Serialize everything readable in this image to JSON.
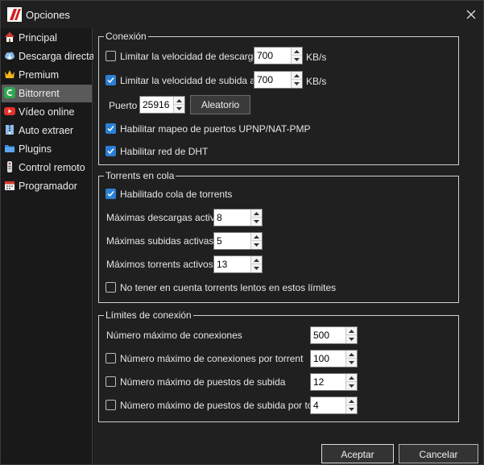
{
  "window": {
    "title": "Opciones"
  },
  "sidebar": {
    "items": [
      {
        "label": "Principal",
        "icon": "home-icon"
      },
      {
        "label": "Descarga directa",
        "icon": "cloud-download-icon"
      },
      {
        "label": "Premium",
        "icon": "crown-icon"
      },
      {
        "label": "Bittorrent",
        "icon": "bittorrent-icon",
        "selected": true
      },
      {
        "label": "Vídeo online",
        "icon": "video-play-icon"
      },
      {
        "label": "Auto extraer",
        "icon": "zip-icon"
      },
      {
        "label": "Plugins",
        "icon": "folder-plugin-icon"
      },
      {
        "label": "Control remoto",
        "icon": "remote-icon"
      },
      {
        "label": "Programador",
        "icon": "calendar-icon"
      }
    ]
  },
  "conexion": {
    "legend": "Conexión",
    "limit_download": {
      "label": "Limitar la velocidad de descarga a",
      "checked": false,
      "value": "700",
      "unit": "KB/s"
    },
    "limit_upload": {
      "label": "Limitar la velocidad de subida a",
      "checked": true,
      "value": "700",
      "unit": "KB/s"
    },
    "port": {
      "label": "Puerto",
      "value": "25916",
      "random_button": "Aleatorio"
    },
    "upnp": {
      "label": "Habilitar mapeo de puertos UPNP/NAT-PMP",
      "checked": true
    },
    "dht": {
      "label": "Habilitar red de DHT",
      "checked": true
    }
  },
  "cola": {
    "legend": "Torrents en cola",
    "enabled": {
      "label": "Habilitado cola de torrents",
      "checked": true
    },
    "max_downloads": {
      "label": "Máximas descargas activas",
      "value": "8"
    },
    "max_uploads": {
      "label": "Máximas subidas activas",
      "value": "5"
    },
    "max_torrents": {
      "label": "Máximos torrents activos",
      "value": "13"
    },
    "ignore_slow": {
      "label": "No tener en cuenta torrents lentos en estos límites",
      "checked": false
    }
  },
  "limites": {
    "legend": "Límites de conexión",
    "max_connections": {
      "label": "Número máximo de conexiones",
      "value": "500"
    },
    "max_conn_per_torrent": {
      "label": "Número máximo de conexiones por torrent",
      "checked": false,
      "value": "100"
    },
    "max_upload_slots": {
      "label": "Número máximo de puestos de subida",
      "checked": false,
      "value": "12"
    },
    "max_upload_slots_per_torrent": {
      "label": "Número máximo de puestos de subida por torrent",
      "checked": false,
      "value": "4"
    }
  },
  "footer": {
    "accept": "Aceptar",
    "cancel": "Cancelar"
  },
  "colors": {
    "accent": "#2b7fd4",
    "selected_bg": "#5a5a5a",
    "window_bg": "#202020"
  }
}
